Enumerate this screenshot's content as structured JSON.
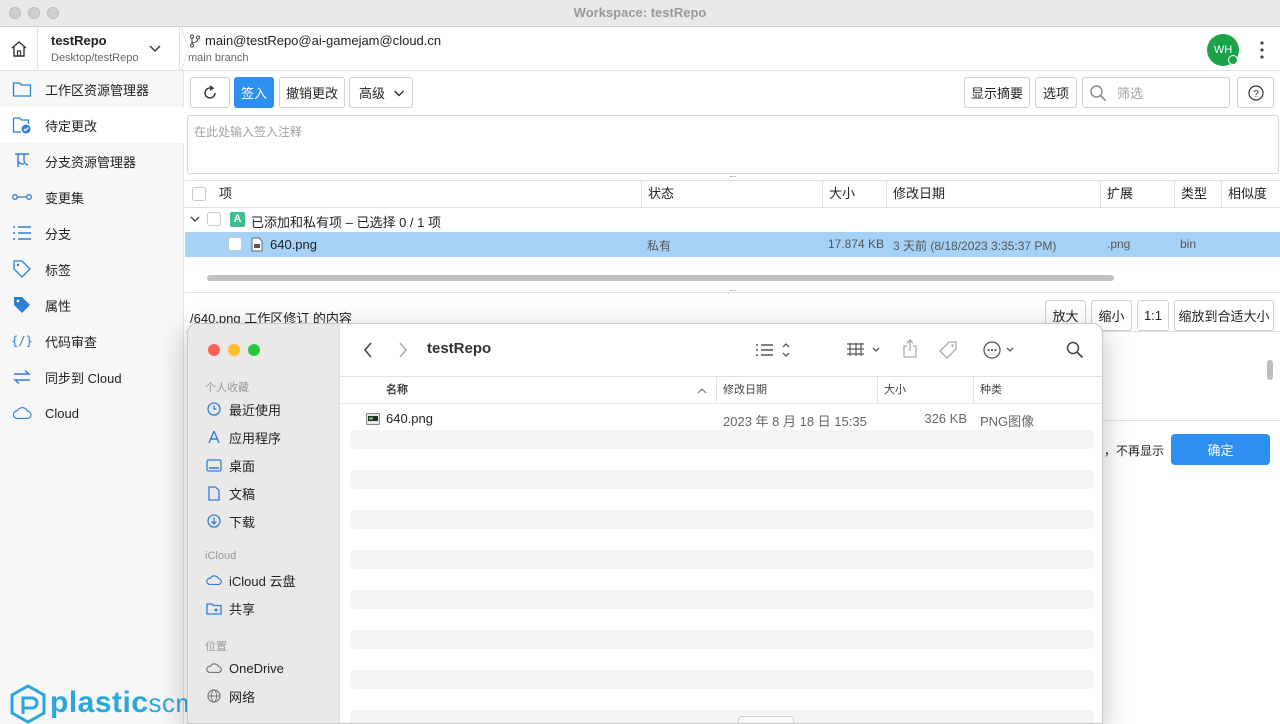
{
  "window": {
    "title": "Workspace: testRepo"
  },
  "header": {
    "repo_name": "testRepo",
    "repo_path": "Desktop/testRepo",
    "branch_full": "main@testRepo@ai-gamejam@cloud.cn",
    "branch_label": "main branch",
    "avatar_initials": "WH"
  },
  "sidebar": {
    "items": [
      {
        "label": "工作区资源管理器",
        "icon": "folder-icon"
      },
      {
        "label": "待定更改",
        "icon": "pending-changes-icon"
      },
      {
        "label": "分支资源管理器",
        "icon": "branch-explorer-icon"
      },
      {
        "label": "变更集",
        "icon": "changeset-icon"
      },
      {
        "label": "分支",
        "icon": "list-icon"
      },
      {
        "label": "标签",
        "icon": "label-icon"
      },
      {
        "label": "属性",
        "icon": "attribute-icon"
      },
      {
        "label": "代码审查",
        "icon": "code-review-icon"
      },
      {
        "label": "同步到 Cloud",
        "icon": "sync-icon"
      },
      {
        "label": "Cloud",
        "icon": "cloud-icon"
      }
    ],
    "logo_text": "plasticscm"
  },
  "toolbar": {
    "checkin": "签入",
    "undo": "撤销更改",
    "advanced": "高级",
    "show_summary": "显示摘要",
    "options": "选项",
    "filter_placeholder": "筛选",
    "comment_placeholder": "在此处输入签入注释"
  },
  "table": {
    "headers": [
      "项",
      "状态",
      "大小",
      "修改日期",
      "扩展",
      "类型",
      "相似度"
    ],
    "group_badge": "A",
    "group_label": "已添加和私有项 – 已选择 0 / 1 项",
    "rows": [
      {
        "name": "640.png",
        "status": "私有",
        "size": "17.874 KB",
        "date": "3 天前 (8/18/2023 3:35:37 PM)",
        "ext": ".png",
        "type": "bin"
      }
    ]
  },
  "preview": {
    "path_label": "/640.png 工作区修订 的内容",
    "zoom_in": "放大",
    "zoom_out": "缩小",
    "actual": "1:1",
    "fit": "缩放到合适大小"
  },
  "notice": {
    "dont_show": "，不再显示",
    "confirm": "确定"
  },
  "finder": {
    "title": "testRepo",
    "sections": {
      "favorites": "个人收藏",
      "icloud": "iCloud",
      "locations": "位置"
    },
    "favorites": [
      "最近使用",
      "应用程序",
      "桌面",
      "文稿",
      "下载"
    ],
    "icloud_items": [
      "iCloud 云盘",
      "共享"
    ],
    "locations": [
      "OneDrive",
      "网络"
    ],
    "columns": [
      "名称",
      "修改日期",
      "大小",
      "种类"
    ],
    "files": [
      {
        "name": "640.png",
        "date": "2023 年 8 月 18 日 15:35",
        "size": "326 KB",
        "kind": "PNG图像"
      }
    ]
  },
  "colors": {
    "accent": "#2d8ff0",
    "selected_row": "#a6d2f7",
    "avatar": "#1aa34a",
    "logo": "#2aa6dd"
  }
}
